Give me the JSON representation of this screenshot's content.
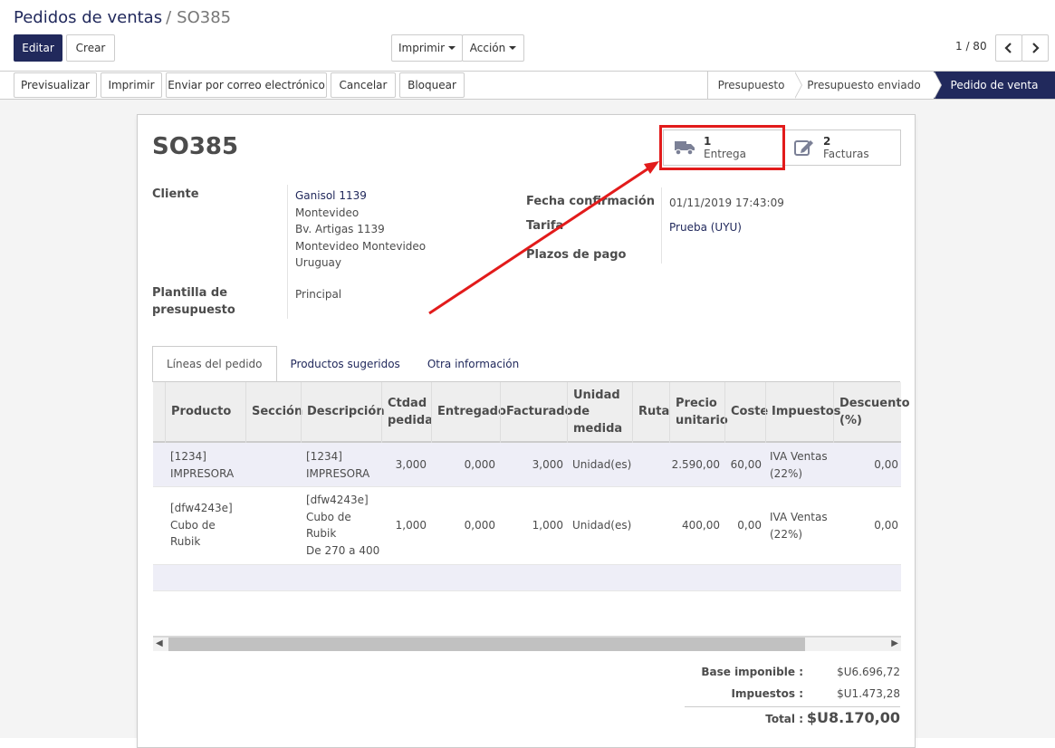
{
  "breadcrumb": {
    "parent": "Pedidos de ventas",
    "separator": "/",
    "current": "SO385"
  },
  "toolbar": {
    "edit_label": "Editar",
    "create_label": "Crear",
    "print_label": "Imprimir",
    "action_label": "Acción",
    "pager": "1 / 80"
  },
  "statusbar": {
    "buttons": [
      "Previsualizar",
      "Imprimir",
      "Enviar por correo electrónico",
      "Cancelar",
      "Bloquear"
    ],
    "stages": [
      "Presupuesto",
      "Presupuesto enviado",
      "Pedido de venta"
    ],
    "active_stage": "Pedido de venta"
  },
  "form": {
    "title": "SO385",
    "smart_buttons": [
      {
        "count": "1",
        "label": "Entrega",
        "icon": "truck-icon"
      },
      {
        "count": "2",
        "label": "Facturas",
        "icon": "pencil-square-icon"
      }
    ],
    "customer_label": "Cliente",
    "customer_name": "Ganisol 1139",
    "customer_address": [
      "Montevideo",
      "Bv. Artigas 1139",
      "Montevideo Montevideo",
      "Uruguay"
    ],
    "template_label_1": "Plantilla de",
    "template_label_2": "presupuesto",
    "template_value": "Principal",
    "confirm_label": "Fecha confirmación",
    "confirm_value": "01/11/2019 17:43:09",
    "pricelist_label": "Tarifa",
    "pricelist_value": "Prueba (UYU)",
    "terms_label": "Plazos de pago"
  },
  "tabs": [
    "Líneas del pedido",
    "Productos sugeridos",
    "Otra información"
  ],
  "table": {
    "headers": {
      "product": "Producto",
      "section": "Sección",
      "description": "Descripción",
      "qty": [
        "Ctdad",
        "pedida"
      ],
      "delivered": "Entregado",
      "invoiced": "Facturado",
      "uom": [
        "Unidad",
        "de",
        "medida"
      ],
      "route": "Ruta",
      "price": [
        "Precio",
        "unitario"
      ],
      "cost": "Coste",
      "taxes": "Impuestos",
      "discount": [
        "Descuento",
        "(%)"
      ]
    },
    "rows": [
      {
        "product": [
          "[1234]",
          "IMPRESORA"
        ],
        "description": [
          "[1234]",
          "IMPRESORA"
        ],
        "qty": "3,000",
        "delivered": "0,000",
        "invoiced": "3,000",
        "uom": "Unidad(es)",
        "price": "2.590,00",
        "cost": "60,00",
        "taxes": [
          "IVA Ventas",
          "(22%)"
        ],
        "discount": "0,00"
      },
      {
        "product": [
          "[dfw4243e]",
          "Cubo de",
          "Rubik"
        ],
        "description": [
          "[dfw4243e]",
          "Cubo de",
          "Rubik",
          "De 270 a 400"
        ],
        "qty": "1,000",
        "delivered": "0,000",
        "invoiced": "1,000",
        "uom": "Unidad(es)",
        "price": "400,00",
        "cost": "0,00",
        "taxes": [
          "IVA Ventas",
          "(22%)"
        ],
        "discount": "0,00"
      }
    ]
  },
  "totals": {
    "base_label": "Base imponible :",
    "base_value": "$U6.696,72",
    "taxes_label": "Impuestos :",
    "taxes_value": "$U1.473,28",
    "total_label": "Total :",
    "total_value": "$U8.170,00"
  },
  "colors": {
    "brand": "#21295c",
    "annotation": "#e21b1b"
  }
}
